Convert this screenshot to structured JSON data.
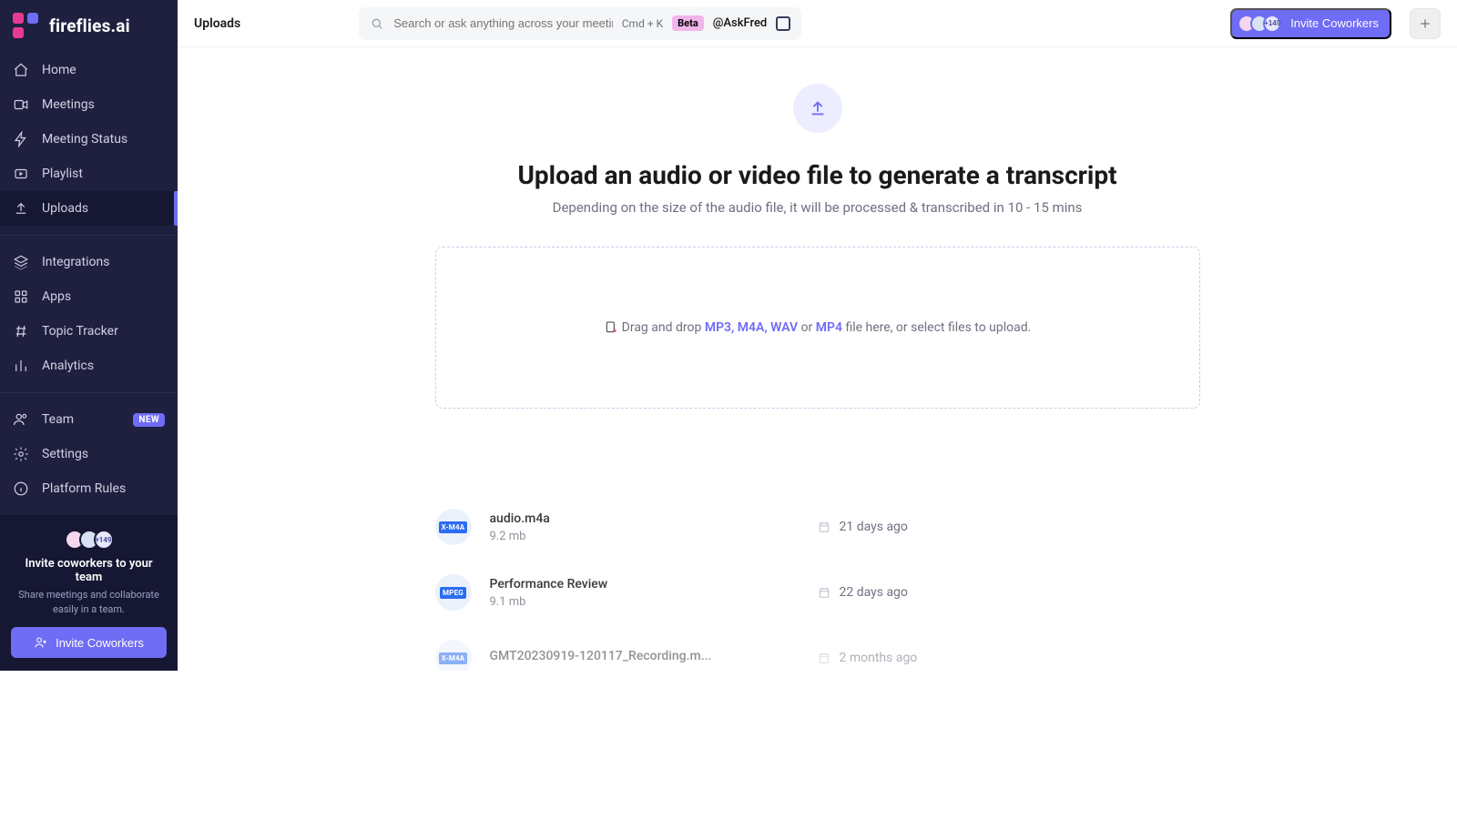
{
  "brand": {
    "name": "fireflies.ai"
  },
  "header": {
    "title": "Uploads",
    "search_placeholder": "Search or ask anything across your meetings...",
    "shortcut": "Cmd + K",
    "beta_label": "Beta",
    "askfred": "@AskFred",
    "invite_label": "Invite Coworkers",
    "overflow_count": "+149"
  },
  "sidebar": {
    "groups": [
      {
        "items": [
          {
            "label": "Home",
            "icon": "home"
          },
          {
            "label": "Meetings",
            "icon": "video"
          },
          {
            "label": "Meeting Status",
            "icon": "bolt"
          },
          {
            "label": "Playlist",
            "icon": "playlist"
          },
          {
            "label": "Uploads",
            "icon": "upload",
            "active": true
          }
        ]
      },
      {
        "items": [
          {
            "label": "Integrations",
            "icon": "stack"
          },
          {
            "label": "Apps",
            "icon": "grid"
          },
          {
            "label": "Topic Tracker",
            "icon": "hash"
          },
          {
            "label": "Analytics",
            "icon": "bars"
          }
        ]
      },
      {
        "items": [
          {
            "label": "Team",
            "icon": "users",
            "badge": "NEW"
          },
          {
            "label": "Settings",
            "icon": "gear"
          },
          {
            "label": "Platform Rules",
            "icon": "info"
          }
        ]
      }
    ],
    "footer": {
      "title": "Invite coworkers to your team",
      "subtitle": "Share meetings and collaborate easily in a team.",
      "cta_label": "Invite Coworkers",
      "overflow_count": "+149"
    }
  },
  "upload_page": {
    "heading": "Upload an audio or video file to generate a transcript",
    "subheading": "Depending on the size of the audio file, it will be processed & transcribed in 10 - 15 mins",
    "drop_pre": "Drag and drop",
    "drop_formats1": "MP3, M4A, WAV",
    "drop_or": "or",
    "drop_formats2": "MP4",
    "drop_post": "file here, or select files to upload.",
    "files": [
      {
        "name": "audio.m4a",
        "size": "9.2 mb",
        "date": "21 days ago",
        "tag": "X-M4A"
      },
      {
        "name": "Performance Review",
        "size": "9.1 mb",
        "date": "22 days ago",
        "tag": "MPEG"
      },
      {
        "name": "GMT20230919-120117_Recording.m...",
        "size": "",
        "date": "2 months ago",
        "tag": "X-M4A",
        "fade": true
      }
    ]
  }
}
